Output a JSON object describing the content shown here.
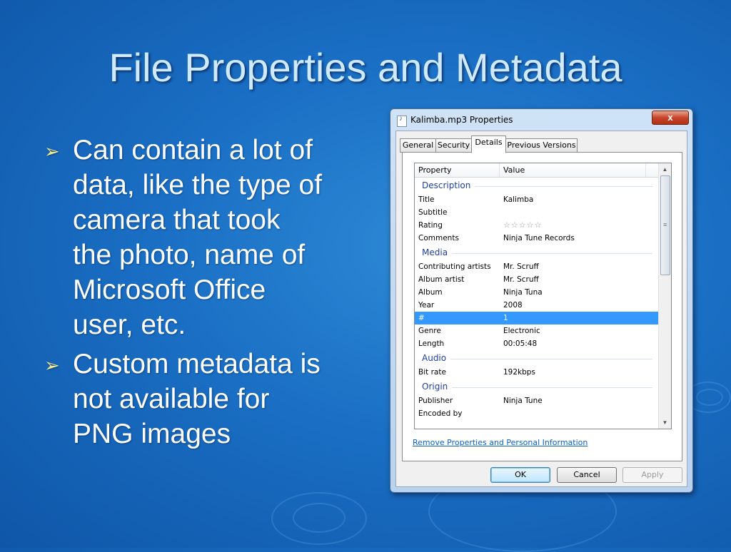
{
  "slide": {
    "title": "File Properties and Metadata",
    "bullets": [
      {
        "text": "Can contain a lot of\ndata, like the type of\ncamera that took\nthe photo, name of\nMicrosoft Office\nuser, etc."
      },
      {
        "text": "Custom metadata is\nnot available for\nPNG images"
      }
    ]
  },
  "dialog": {
    "title": "Kalimba.mp3 Properties",
    "close_label": "x",
    "tabs": [
      "General",
      "Security",
      "Details",
      "Previous Versions"
    ],
    "active_tab": "Details",
    "columns": [
      "Property",
      "Value"
    ],
    "groups": [
      {
        "name": "Description",
        "rows": [
          {
            "property": "Title",
            "value": "Kalimba"
          },
          {
            "property": "Subtitle",
            "value": ""
          },
          {
            "property": "Rating",
            "value": "☆☆☆☆☆",
            "stars": 0
          },
          {
            "property": "Comments",
            "value": "Ninja Tune Records"
          }
        ]
      },
      {
        "name": "Media",
        "rows": [
          {
            "property": "Contributing artists",
            "value": "Mr. Scruff"
          },
          {
            "property": "Album artist",
            "value": "Mr. Scruff"
          },
          {
            "property": "Album",
            "value": "Ninja Tuna"
          },
          {
            "property": "Year",
            "value": "2008"
          },
          {
            "property": "#",
            "value": "1",
            "selected": true
          },
          {
            "property": "Genre",
            "value": "Electronic"
          },
          {
            "property": "Length",
            "value": "00:05:48"
          }
        ]
      },
      {
        "name": "Audio",
        "rows": [
          {
            "property": "Bit rate",
            "value": "192kbps"
          }
        ]
      },
      {
        "name": "Origin",
        "rows": [
          {
            "property": "Publisher",
            "value": "Ninja Tune"
          },
          {
            "property": "Encoded by",
            "value": ""
          }
        ]
      }
    ],
    "link_text": "Remove Properties and Personal Information",
    "buttons": {
      "ok": "OK",
      "cancel": "Cancel",
      "apply": "Apply"
    }
  }
}
